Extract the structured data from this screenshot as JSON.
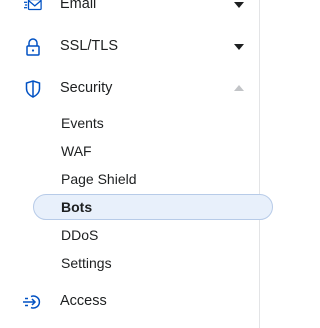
{
  "nav": {
    "email": {
      "label": "Email",
      "icon": "email-icon",
      "state": "collapsed"
    },
    "ssl": {
      "label": "SSL/TLS",
      "icon": "lock-icon",
      "state": "collapsed"
    },
    "security": {
      "label": "Security",
      "icon": "shield-icon",
      "state": "expanded",
      "children": [
        {
          "label": "Events",
          "active": false
        },
        {
          "label": "WAF",
          "active": false
        },
        {
          "label": "Page Shield",
          "active": false
        },
        {
          "label": "Bots",
          "active": true
        },
        {
          "label": "DDoS",
          "active": false
        },
        {
          "label": "Settings",
          "active": false
        }
      ]
    },
    "access": {
      "label": "Access",
      "icon": "access-icon"
    }
  },
  "colors": {
    "icon": "#0051c3",
    "text": "#1d1f20",
    "active_bg": "#e8f0fb",
    "active_border": "#b7cbe8",
    "chevron_active": "#1d1f20",
    "chevron_muted": "#c2c4c7"
  }
}
